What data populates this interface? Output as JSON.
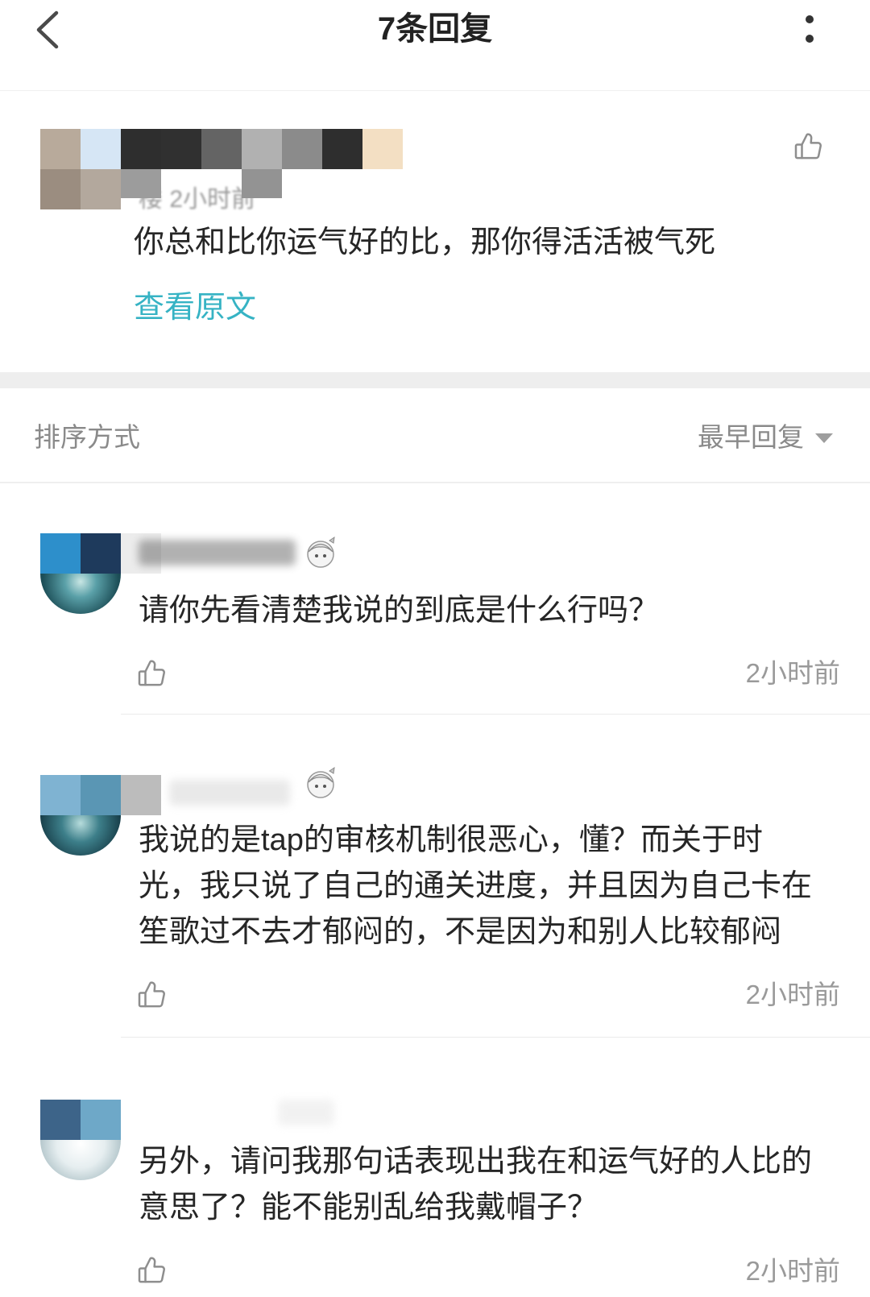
{
  "header": {
    "title": "7条回复",
    "back_icon": "chevron-left-icon",
    "menu_icon": "more-vertical-icon"
  },
  "original": {
    "meta": "楼  2小时前",
    "text": "你总和比你运气好的比，那你得活活被气死",
    "view_original": "查看原文",
    "like_icon": "thumbs-up-icon"
  },
  "sort": {
    "label": "排序方式",
    "selected": "最早回复",
    "dropdown_icon": "caret-down-icon"
  },
  "replies": [
    {
      "lines": [
        "请你先看清楚我说的到底是什么行吗？"
      ],
      "time": "2小时前"
    },
    {
      "lines": [
        "我说的是tap的审核机制很恶心，懂？而关于时",
        "光，我只说了自己的通关进度，并且因为自己卡在",
        "笙歌过不去才郁闷的，不是因为和别人比较郁闷"
      ],
      "time": "2小时前"
    },
    {
      "lines": [
        "另外，请问我那句话表现出我在和运气好的人比的",
        "意思了？能不能别乱给我戴帽子？"
      ],
      "time": "2小时前"
    }
  ],
  "colors": {
    "accent": "#36b3c4",
    "text": "#262626",
    "muted": "#9a9a9a",
    "separator": "#eeeeee"
  }
}
